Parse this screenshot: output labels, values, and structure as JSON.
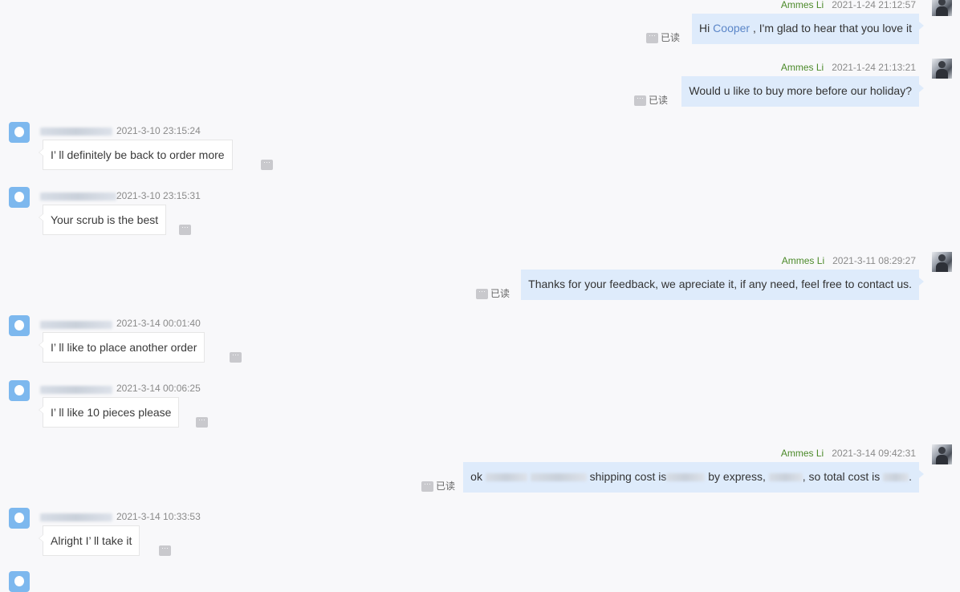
{
  "me_name": "Ammes Li",
  "read_label": "已读",
  "more_glyph": "···",
  "messages": [
    {
      "time": "2021-1-24 21:12:57",
      "pre": "Hi ",
      "highlight": "Cooper",
      "post": " , I'm glad to hear that you love it"
    },
    {
      "time": "2021-1-24 21:13:21",
      "text": "Would u like to buy more before our holiday?"
    },
    {
      "time": "2021-3-10 23:15:24",
      "text": "I’ ll definitely be back to order more"
    },
    {
      "time": "2021-3-10 23:15:31",
      "text": "Your scrub is the best"
    },
    {
      "time": "2021-3-11 08:29:27",
      "text": "Thanks for your feedback, we apreciate it, if any need, feel free to contact us."
    },
    {
      "time": "2021-3-14 00:01:40",
      "text": "I’ ll like to place another order"
    },
    {
      "time": "2021-3-14 00:06:25",
      "text": "I’ ll like 10 pieces please"
    },
    {
      "time": "2021-3-14 09:42:31",
      "p1": "ok",
      "p2": "shipping cost is",
      "p3": "by express,",
      "p4": ", so total cost is",
      "p5": "."
    },
    {
      "time": "2021-3-14 10:33:53",
      "text": "Alright I’ ll take it"
    }
  ]
}
